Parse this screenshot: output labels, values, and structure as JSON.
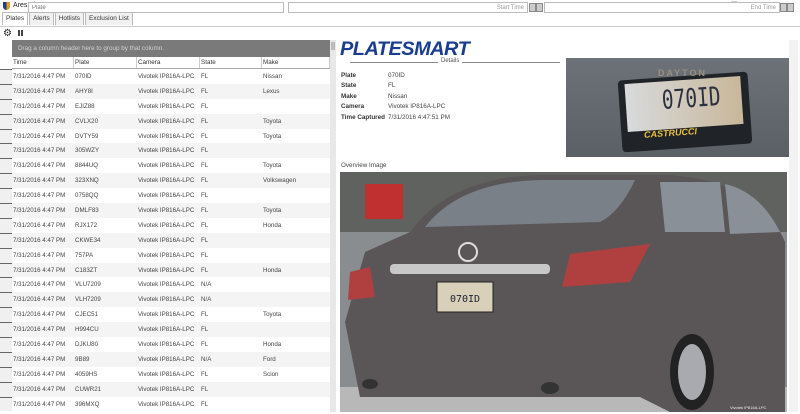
{
  "window": {
    "title": "Ares Viewer",
    "minimize": "–",
    "maximize": "❐",
    "close": "✕"
  },
  "tabs": [
    {
      "label": "Plates",
      "active": true
    },
    {
      "label": "Alerts"
    },
    {
      "label": "Hotlists"
    },
    {
      "label": "Exclusion List"
    }
  ],
  "toolbar": {
    "plate_placeholder": "Plate",
    "start_time_label": "Start Time",
    "end_time_label": "End Time",
    "settings_icon": "gear-icon",
    "pause_icon": "pause-icon"
  },
  "grid": {
    "group_hint": "Drag a column header here to group by that column.",
    "columns": [
      "Time",
      "Plate",
      "Camera",
      "State",
      "Make"
    ],
    "rows": [
      [
        "7/31/2016 4:47 PM",
        "070ID",
        "Vivotek IP816A-LPC",
        "FL",
        "Nissan"
      ],
      [
        "7/31/2016 4:47 PM",
        "AHY8I",
        "Vivotek IP816A-LPC",
        "FL",
        "Lexus"
      ],
      [
        "7/31/2016 4:47 PM",
        "EJIZ88",
        "Vivotek IP816A-LPC",
        "FL",
        ""
      ],
      [
        "7/31/2016 4:47 PM",
        "CVLX20",
        "Vivotek IP816A-LPC",
        "FL",
        "Toyota"
      ],
      [
        "7/31/2016 4:47 PM",
        "DVTY59",
        "Vivotek IP816A-LPC",
        "FL",
        "Toyota"
      ],
      [
        "7/31/2016 4:47 PM",
        "305WZY",
        "Vivotek IP816A-LPC",
        "FL",
        ""
      ],
      [
        "7/31/2016 4:47 PM",
        "8844UQ",
        "Vivotek IP816A-LPC",
        "FL",
        "Toyota"
      ],
      [
        "7/31/2016 4:47 PM",
        "323XNQ",
        "Vivotek IP816A-LPC",
        "FL",
        "Volkswagen"
      ],
      [
        "7/31/2016 4:47 PM",
        "0758QQ",
        "Vivotek IP816A-LPC",
        "FL",
        ""
      ],
      [
        "7/31/2016 4:47 PM",
        "DMLF83",
        "Vivotek IP816A-LPC",
        "FL",
        "Toyota"
      ],
      [
        "7/31/2016 4:47 PM",
        "RJX172",
        "Vivotek IP816A-LPC",
        "FL",
        "Honda"
      ],
      [
        "7/31/2016 4:47 PM",
        "CKWE34",
        "Vivotek IP816A-LPC",
        "FL",
        ""
      ],
      [
        "7/31/2016 4:47 PM",
        "757PA",
        "Vivotek IP816A-LPC",
        "FL",
        ""
      ],
      [
        "7/31/2016 4:47 PM",
        "C183ZT",
        "Vivotek IP816A-LPC",
        "FL",
        "Honda"
      ],
      [
        "7/31/2016 4:47 PM",
        "VLU7209",
        "Vivotek IP816A-LPC",
        "N/A",
        ""
      ],
      [
        "7/31/2016 4:47 PM",
        "VLH7209",
        "Vivotek IP816A-LPC",
        "N/A",
        ""
      ],
      [
        "7/31/2016 4:47 PM",
        "CJEC51",
        "Vivotek IP816A-LPC",
        "FL",
        "Toyota"
      ],
      [
        "7/31/2016 4:47 PM",
        "H994CU",
        "Vivotek IP816A-LPC",
        "FL",
        ""
      ],
      [
        "7/31/2016 4:47 PM",
        "DJKU80",
        "Vivotek IP816A-LPC",
        "FL",
        "Honda"
      ],
      [
        "7/31/2016 4:47 PM",
        "9B89",
        "Vivotek IP816A-LPC",
        "N/A",
        "Ford"
      ],
      [
        "7/31/2016 4:47 PM",
        "4059HS",
        "Vivotek IP816A-LPC",
        "FL",
        "Scion"
      ],
      [
        "7/31/2016 4:47 PM",
        "CUWR21",
        "Vivotek IP816A-LPC",
        "FL",
        ""
      ],
      [
        "7/31/2016 4:47 PM",
        "396MXQ",
        "Vivotek IP816A-LPC",
        "FL",
        ""
      ]
    ]
  },
  "details": {
    "logo": "PLATESMART",
    "section_label": "Details",
    "fields": [
      {
        "label": "Plate",
        "value": "070ID"
      },
      {
        "label": "State",
        "value": "FL"
      },
      {
        "label": "Make",
        "value": "Nissan"
      },
      {
        "label": "Camera",
        "value": "Vivotek IP816A-LPC"
      },
      {
        "label": "Time Captured",
        "value": "7/31/2016 4:47:51 PM"
      }
    ],
    "plate_image": {
      "top_text": "DAYTON",
      "plate_text": "070ID",
      "frame_text": "CASTRUCCI"
    },
    "overview_label": "Overview Image",
    "overview_caption": "Vivotek IP816A-LPC"
  }
}
